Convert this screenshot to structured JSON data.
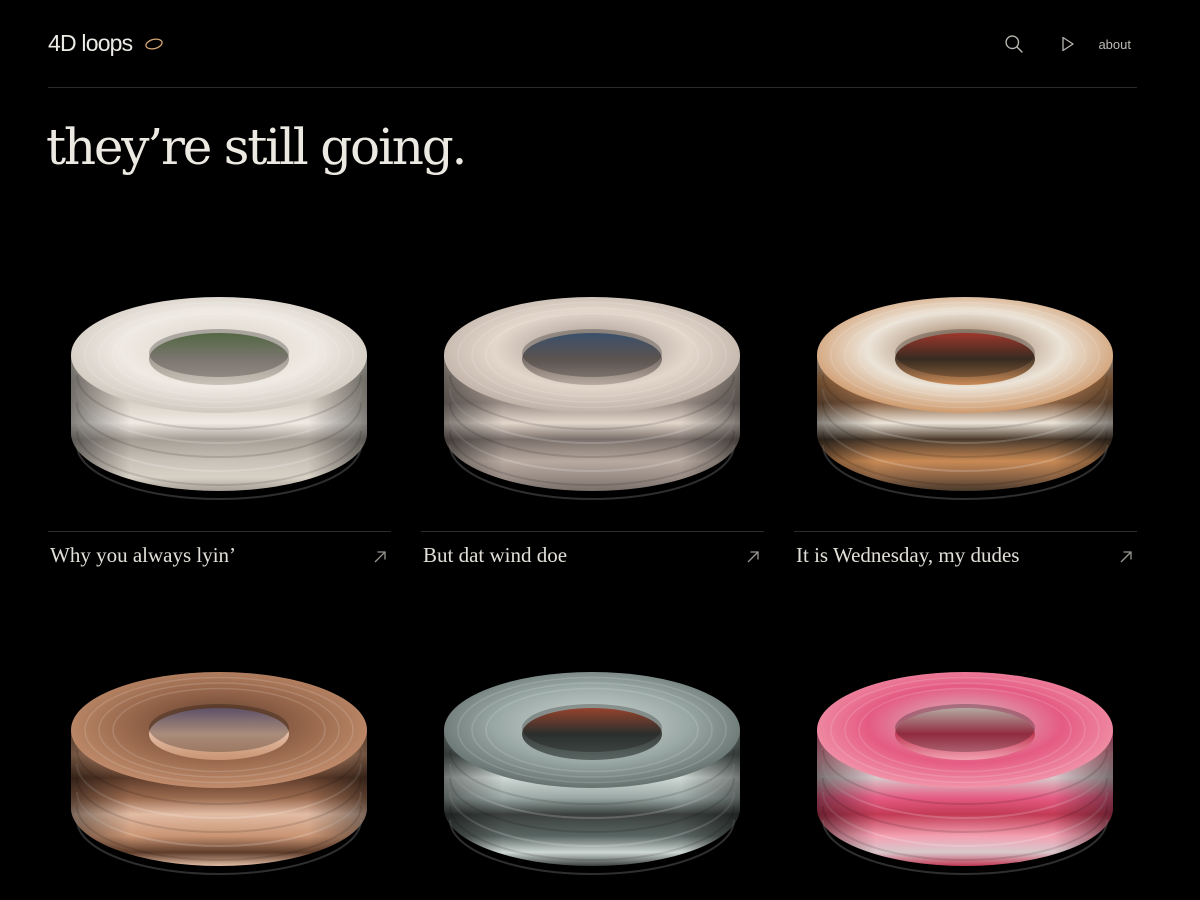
{
  "app": {
    "logo_text": "4D loops",
    "logo_mark_icon": "ring-icon",
    "accent_color": "#d4a574"
  },
  "nav": {
    "search_icon": "search-icon",
    "play_icon": "play-icon",
    "about_label": "about"
  },
  "hero": {
    "title": "they’re still going."
  },
  "loops": [
    {
      "title": "Why you always lyin’",
      "arrow_icon": "arrow-up-right-icon",
      "palette": [
        "#efeae3",
        "#c9c2b8",
        "#d8d1c6",
        "#a59e95",
        "#6f8a5a"
      ]
    },
    {
      "title": "But dat wind doe",
      "arrow_icon": "arrow-up-right-icon",
      "palette": [
        "#e3d7cc",
        "#b8aaa0",
        "#9a8d86",
        "#7a6f6a",
        "#4f6b8f"
      ]
    },
    {
      "title": "It is Wednesday, my dudes",
      "arrow_icon": "arrow-up-right-icon",
      "palette": [
        "#ece4d8",
        "#c98a55",
        "#8a6244",
        "#4a3a2c",
        "#d1493b"
      ]
    },
    {
      "title": "",
      "arrow_icon": "",
      "palette": [
        "#9c6b4f",
        "#c99473",
        "#5e3c2a",
        "#e2bca4",
        "#7d6c8a"
      ]
    },
    {
      "title": "",
      "arrow_icon": "",
      "palette": [
        "#9aa8a5",
        "#5a6663",
        "#cfd8d4",
        "#3a3f3d",
        "#c75a3c"
      ]
    },
    {
      "title": "",
      "arrow_icon": "",
      "palette": [
        "#e55b82",
        "#f3a1b2",
        "#d8c8cc",
        "#c23a55",
        "#f1e2d8"
      ]
    }
  ]
}
